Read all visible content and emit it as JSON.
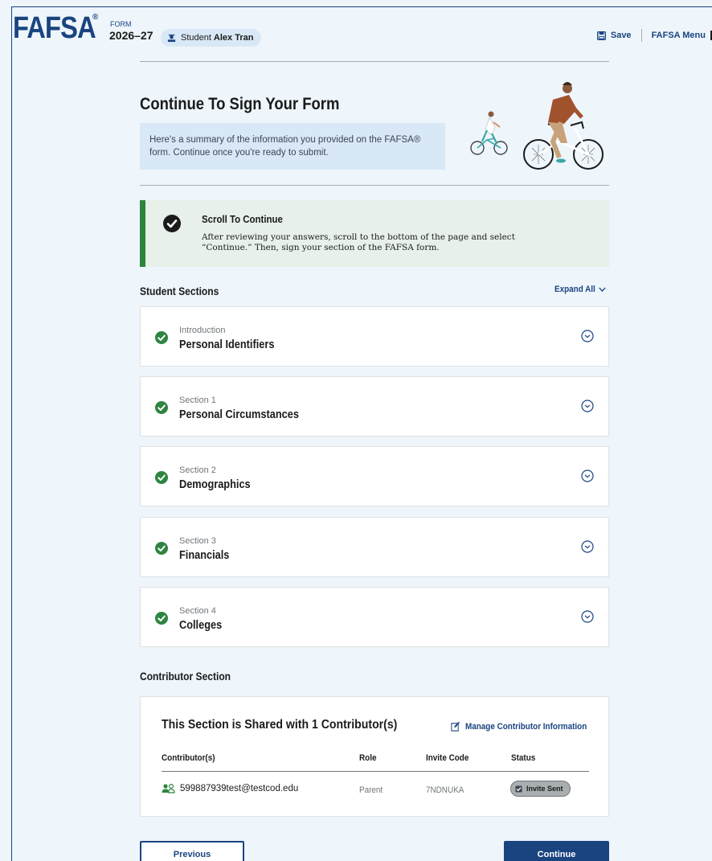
{
  "header": {
    "logo": "FAFSA",
    "registered": "®",
    "form_label": "FORM",
    "form_year": "2026–27",
    "student_prefix": "Student",
    "student_name": "Alex Tran",
    "save_label": "Save",
    "menu_label": "FAFSA Menu"
  },
  "hero": {
    "title": "Continue To Sign Your Form",
    "summary_line1": "Here's a summary of the information you provided on the FAFSA®",
    "summary_line2": "form. Continue once you're ready to submit."
  },
  "alert": {
    "title": "Scroll To Continue",
    "text_line1": "After reviewing your answers, scroll to the bottom of the page and select",
    "text_line2": "“Continue.” Then, sign your section of the FAFSA form."
  },
  "student_sections": {
    "heading": "Student Sections",
    "expand_all_label": "Expand All",
    "items": [
      {
        "subtitle": "Introduction",
        "title": "Personal Identifiers"
      },
      {
        "subtitle": "Section 1",
        "title": "Personal Circumstances"
      },
      {
        "subtitle": "Section 2",
        "title": "Demographics"
      },
      {
        "subtitle": "Section 3",
        "title": "Financials"
      },
      {
        "subtitle": "Section 4",
        "title": "Colleges"
      }
    ]
  },
  "contributor_section": {
    "heading": "Contributor Section",
    "card_title": "This Section is Shared with 1 Contributor(s)",
    "manage_label": "Manage Contributor Information",
    "columns": [
      "Contributor(s)",
      "Role",
      "Invite Code",
      "Status"
    ],
    "rows": [
      {
        "email": "599887939test@testcod.edu",
        "role": "Parent",
        "invite_code": "7NDNUKA",
        "status": "Invite Sent"
      }
    ]
  },
  "footer": {
    "previous_label": "Previous",
    "continue_label": "Continue"
  },
  "colors": {
    "brand_blue": "#1a4480",
    "success_green": "#2e8540",
    "page_bg": "#eef5fb",
    "info_bg": "#d9e8f6",
    "alert_bg": "#e7f0e9"
  }
}
